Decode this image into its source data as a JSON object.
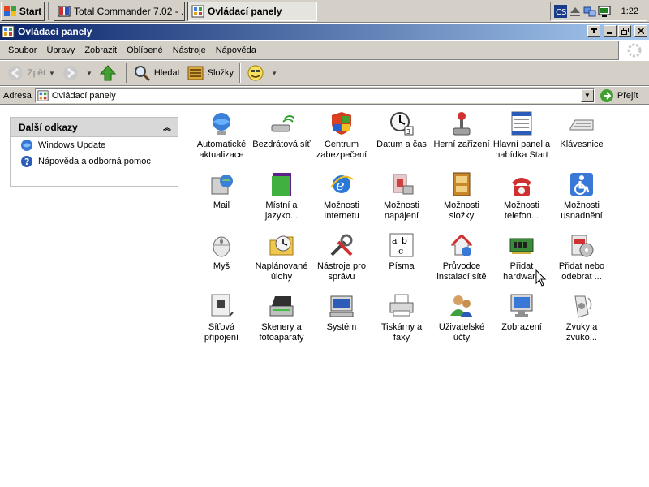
{
  "taskbar": {
    "start_label": "Start",
    "tasks": [
      {
        "label": "Total Commander 7.02 - ...",
        "active": false
      },
      {
        "label": "Ovládací panely",
        "active": true
      }
    ],
    "clock": "1:22"
  },
  "window": {
    "title": "Ovládací panely"
  },
  "menu": {
    "items": [
      "Soubor",
      "Úpravy",
      "Zobrazit",
      "Oblíbené",
      "Nástroje",
      "Nápověda"
    ]
  },
  "toolbar": {
    "back_label": "Zpět",
    "search_label": "Hledat",
    "folders_label": "Složky"
  },
  "address": {
    "label": "Adresa",
    "value": "Ovládací panely",
    "go_label": "Přejít"
  },
  "task_pane": {
    "title": "Další odkazy",
    "links": [
      "Windows Update",
      "Nápověda a odborná pomoc"
    ]
  },
  "icons": [
    {
      "label": "Automatické\naktualizace",
      "icon": "globe-icon"
    },
    {
      "label": "Bezdrátová síť",
      "icon": "wireless-icon"
    },
    {
      "label": "Centrum\nzabezpečení",
      "icon": "shield-icon"
    },
    {
      "label": "Datum a čas",
      "icon": "clock-icon"
    },
    {
      "label": "Herní zařízení",
      "icon": "joystick-icon"
    },
    {
      "label": "Hlavní panel a\nnabídka Start",
      "icon": "taskbar-icon"
    },
    {
      "label": "Klávesnice",
      "icon": "keyboard-icon"
    },
    {
      "label": "Mail",
      "icon": "mail-icon"
    },
    {
      "label": "Místní a\njazyko...",
      "icon": "regional-icon"
    },
    {
      "label": "Možnosti\nInternetu",
      "icon": "ie-icon"
    },
    {
      "label": "Možnosti\nnapájení",
      "icon": "power-icon"
    },
    {
      "label": "Možnosti\nsložky",
      "icon": "folder-options-icon"
    },
    {
      "label": "Možnosti\ntelefon...",
      "icon": "phone-icon"
    },
    {
      "label": "Možnosti\nusnadnění",
      "icon": "accessibility-icon"
    },
    {
      "label": "Myš",
      "icon": "mouse-icon"
    },
    {
      "label": "Naplánované\núlohy",
      "icon": "scheduled-tasks-icon"
    },
    {
      "label": "Nástroje pro\nsprávu",
      "icon": "admin-tools-icon"
    },
    {
      "label": "Písma",
      "icon": "fonts-icon"
    },
    {
      "label": "Průvodce\ninstalací sítě",
      "icon": "network-wizard-icon"
    },
    {
      "label": "Přidat\nhardware",
      "icon": "hardware-icon"
    },
    {
      "label": "Přidat nebo\nodebrat ...",
      "icon": "add-remove-icon"
    },
    {
      "label": "Síťová\npřipojení",
      "icon": "network-connections-icon"
    },
    {
      "label": "Skenery a\nfotoaparáty",
      "icon": "scanner-icon"
    },
    {
      "label": "Systém",
      "icon": "system-icon"
    },
    {
      "label": "Tiskárny a\nfaxy",
      "icon": "printer-icon"
    },
    {
      "label": "Uživatelské\núčty",
      "icon": "users-icon"
    },
    {
      "label": "Zobrazení",
      "icon": "display-icon"
    },
    {
      "label": "Zvuky a\nzvuko...",
      "icon": "sounds-icon"
    }
  ]
}
